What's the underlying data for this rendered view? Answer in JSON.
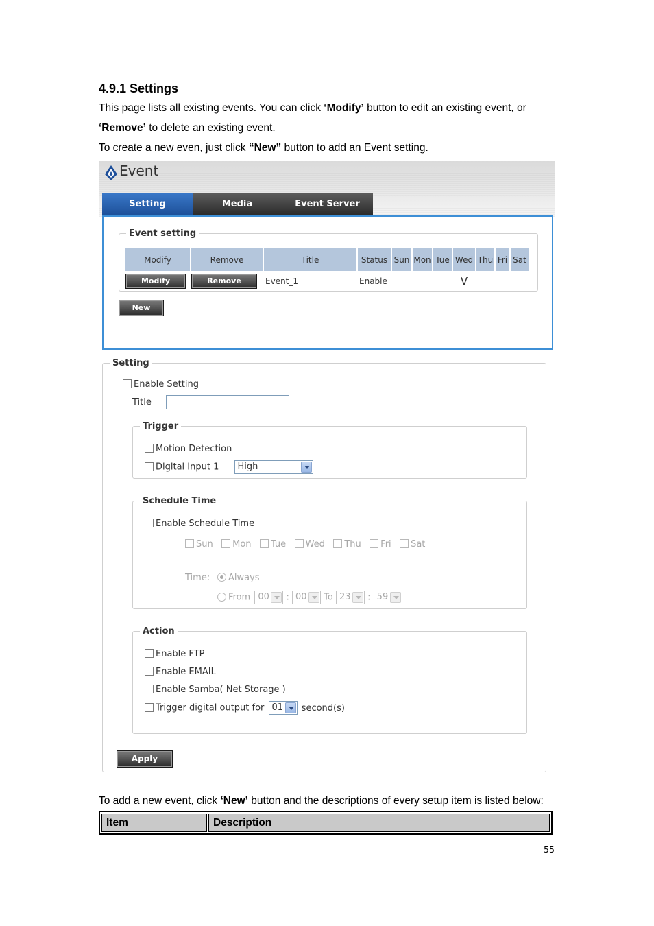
{
  "heading": "4.9.1 Settings",
  "intro": {
    "line1_a": "This page lists all existing events. You can click ",
    "line1_b": "‘Modify’",
    "line1_c": " button to edit an existing event, or",
    "line2_a": "‘Remove’",
    "line2_b": " to delete an existing event.",
    "line3_a": "To create a new even, just click ",
    "line3_b": "“New”",
    "line3_c": " button to add an Event setting."
  },
  "screenshot": {
    "page_title": "Event",
    "tabs": [
      "Setting",
      "Media",
      "Event Server"
    ],
    "event_setting": {
      "legend": "Event setting",
      "columns": [
        "Modify",
        "Remove",
        "Title",
        "Status",
        "Sun",
        "Mon",
        "Tue",
        "Wed",
        "Thu",
        "Fri",
        "Sat"
      ],
      "rows": [
        {
          "modify_label": "Modify",
          "remove_label": "Remove",
          "title": "Event_1",
          "status": "Enable",
          "sun": "",
          "mon": "",
          "tue": "",
          "wed": "V",
          "thu": "",
          "fri": "",
          "sat": ""
        }
      ],
      "new_label": "New"
    },
    "setting": {
      "legend": "Setting",
      "enable_label": "Enable Setting",
      "title_label": "Title",
      "title_value": "",
      "trigger": {
        "legend": "Trigger",
        "motion_label": "Motion Detection",
        "digital_label": "Digital Input 1",
        "digital_value": "High"
      },
      "schedule": {
        "legend": "Schedule Time",
        "enable_label": "Enable Schedule Time",
        "days": [
          "Sun",
          "Mon",
          "Tue",
          "Wed",
          "Thu",
          "Fri",
          "Sat"
        ],
        "time_label": "Time:",
        "always_label": "Always",
        "from_label": "From",
        "from_hour": "00",
        "from_min": "00",
        "to_label": "To",
        "to_hour": "23",
        "to_min": "59",
        "colon": ":"
      },
      "action": {
        "legend": "Action",
        "ftp_label": "Enable FTP",
        "email_label": "Enable EMAIL",
        "samba_label": "Enable Samba( Net Storage )",
        "output_label": "Trigger digital output for",
        "output_value": "01",
        "seconds_label": "second(s)"
      },
      "apply_label": "Apply"
    }
  },
  "outro": {
    "a": "To add a new event, click ",
    "b": "‘New’",
    "c": " button and the descriptions of every setup item is listed below:"
  },
  "table": {
    "col1": "Item",
    "col2": "Description"
  },
  "page_number": "55",
  "colors": {
    "tab_active": "#2a64b4",
    "panel_border": "#3d8fd6",
    "header_cell": "#b4c6dc"
  }
}
